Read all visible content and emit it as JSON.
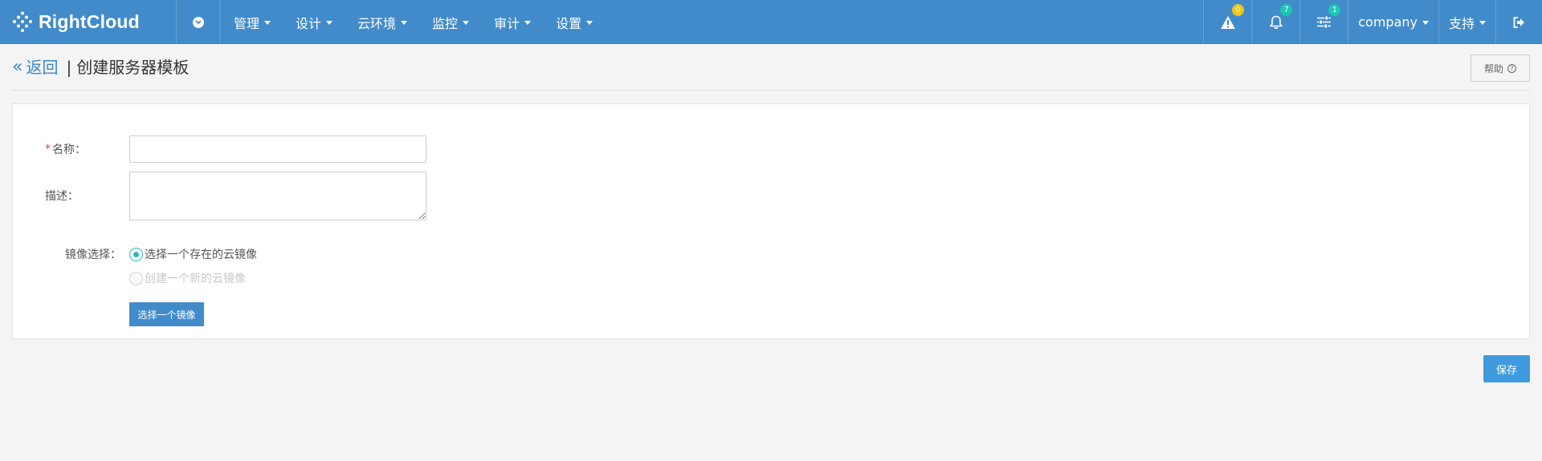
{
  "brand": {
    "name": "RightCloud"
  },
  "nav": {
    "menu": [
      {
        "label": "管理"
      },
      {
        "label": "设计"
      },
      {
        "label": "云环境"
      },
      {
        "label": "监控"
      },
      {
        "label": "审计"
      },
      {
        "label": "设置"
      }
    ],
    "alerts_count": "0",
    "notifications_count": "7",
    "tasks_count": "1",
    "company_label": "company",
    "support_label": "支持"
  },
  "header": {
    "back_label": "返回",
    "separator": "|",
    "title": "创建服务器模板",
    "help_label": "帮助"
  },
  "form": {
    "name_required_mark": "*",
    "name_label": "名称：",
    "name_value": "",
    "desc_label": "描述：",
    "desc_value": "",
    "image_label": "镜像选择：",
    "option_existing": "选择一个存在的云镜像",
    "option_new": "创建一个新的云镜像",
    "select_button": "选择一个镜像"
  },
  "footer": {
    "save_label": "保存"
  },
  "colors": {
    "navbar": "#428bca",
    "link": "#3a87c8",
    "radio_active": "#2db7c9",
    "save_button": "#3f9ade",
    "badge_yellow": "#f0c419",
    "badge_teal": "#1dc6b4",
    "required": "#e83d3d"
  },
  "icons": {
    "logo": "rightcloud-logo-icon",
    "toggle": "chevron-down-circle-icon",
    "alert": "warning-icon",
    "notify": "bell-icon",
    "tasks": "sliders-icon",
    "logout": "sign-out-icon"
  }
}
